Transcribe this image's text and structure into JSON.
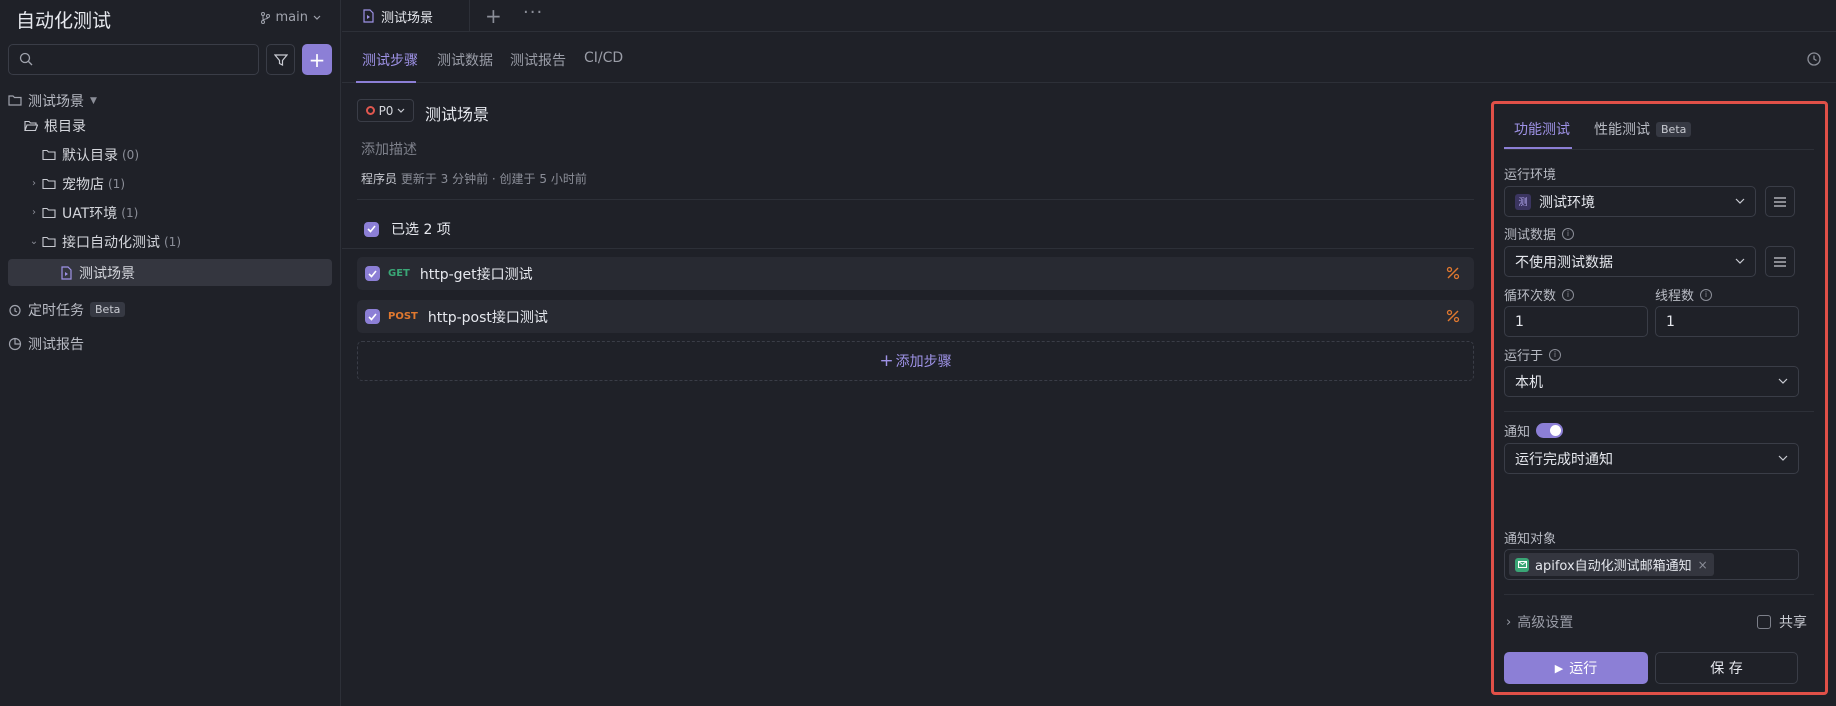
{
  "sidebar": {
    "app_title": "自动化测试",
    "branch": "main",
    "search": {
      "placeholder": ""
    },
    "tree": {
      "root_section": "测试场景",
      "root_dir": "根目录",
      "items": [
        {
          "label": "默认目录",
          "count": "(0)"
        },
        {
          "label": "宠物店",
          "count": "(1)"
        },
        {
          "label": "UAT环境",
          "count": "(1)"
        },
        {
          "label": "接口自动化测试",
          "count": "(1)"
        },
        {
          "label": "测试场景",
          "count": ""
        }
      ]
    },
    "scheduled": {
      "label": "定时任务",
      "badge": "Beta"
    },
    "reports": {
      "label": "测试报告"
    }
  },
  "tabbar": {
    "doc_tab": "测试场景",
    "plus": "+",
    "more": "···"
  },
  "subtabs": [
    "测试步骤",
    "测试数据",
    "测试报告",
    "CI/CD"
  ],
  "scene": {
    "priority": "P0",
    "title": "测试场景",
    "add_desc": "添加描述",
    "author": "程序员",
    "meta_text": "更新于 3 分钟前 · 创建于 5 小时前",
    "selected": "已选 2 项",
    "steps": [
      {
        "method": "GET",
        "name": "http-get接口测试",
        "method_color": "#3aa676"
      },
      {
        "method": "POST",
        "name": "http-post接口测试",
        "method_color": "#e0782f"
      }
    ],
    "add_step": "添加步骤"
  },
  "panel": {
    "tabs": {
      "functional": "功能测试",
      "performance": "性能测试",
      "perf_badge": "Beta"
    },
    "env_label": "运行环境",
    "env_chip": "测",
    "env_value": "测试环境",
    "data_label": "测试数据",
    "data_value": "不使用测试数据",
    "loop_label": "循环次数",
    "loop_value": "1",
    "thread_label": "线程数",
    "thread_value": "1",
    "run_on_label": "运行于",
    "run_on_value": "本机",
    "notify_label": "通知",
    "notify_enabled": true,
    "notify_value": "运行完成时通知",
    "notify_target_label": "通知对象",
    "notify_target": "apifox自动化测试邮箱通知",
    "advanced": "高级设置",
    "share": "共享",
    "run_btn": "运行",
    "save_btn": "保 存"
  },
  "colors": {
    "accent": "#8c7fd6",
    "highlight_border": "#e05048",
    "get": "#3aa676",
    "post": "#e0782f"
  }
}
